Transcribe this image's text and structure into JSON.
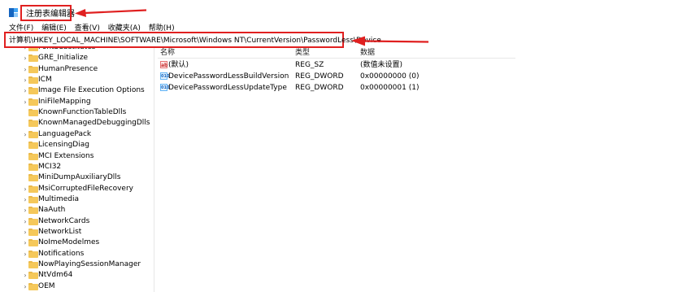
{
  "window": {
    "title": "注册表编辑器",
    "icon": "registry-editor-icon"
  },
  "menu": [
    "文件(F)",
    "编辑(E)",
    "查看(V)",
    "收藏夹(A)",
    "帮助(H)"
  ],
  "address": {
    "path": "计算机\\HKEY_LOCAL_MACHINE\\SOFTWARE\\Microsoft\\Windows NT\\CurrentVersion\\PasswordLess\\Device"
  },
  "tree": [
    {
      "label": "FontSubstitutes",
      "expandable": true
    },
    {
      "label": "GRE_Initialize",
      "expandable": true
    },
    {
      "label": "HumanPresence",
      "expandable": true
    },
    {
      "label": "ICM",
      "expandable": true
    },
    {
      "label": "Image File Execution Options",
      "expandable": true
    },
    {
      "label": "IniFileMapping",
      "expandable": true
    },
    {
      "label": "KnownFunctionTableDlls",
      "expandable": false
    },
    {
      "label": "KnownManagedDebuggingDlls",
      "expandable": false
    },
    {
      "label": "LanguagePack",
      "expandable": true
    },
    {
      "label": "LicensingDiag",
      "expandable": false
    },
    {
      "label": "MCI Extensions",
      "expandable": false
    },
    {
      "label": "MCI32",
      "expandable": false
    },
    {
      "label": "MiniDumpAuxiliaryDlls",
      "expandable": false
    },
    {
      "label": "MsiCorruptedFileRecovery",
      "expandable": true
    },
    {
      "label": "Multimedia",
      "expandable": true
    },
    {
      "label": "NaAuth",
      "expandable": true
    },
    {
      "label": "NetworkCards",
      "expandable": true
    },
    {
      "label": "NetworkList",
      "expandable": true
    },
    {
      "label": "NoImeModelmes",
      "expandable": true
    },
    {
      "label": "Notifications",
      "expandable": true
    },
    {
      "label": "NowPlayingSessionManager",
      "expandable": false
    },
    {
      "label": "NtVdm64",
      "expandable": true
    },
    {
      "label": "OEM",
      "expandable": true
    }
  ],
  "columns": {
    "name": "名称",
    "type": "类型",
    "data": "数据"
  },
  "values": [
    {
      "icon": "string-value-icon",
      "icon_text": "ab",
      "name": "(默认)",
      "type": "REG_SZ",
      "data": "(数值未设置)"
    },
    {
      "icon": "binary-value-icon",
      "icon_text": "010",
      "name": "DevicePasswordLessBuildVersion",
      "type": "REG_DWORD",
      "data": "0x00000000 (0)"
    },
    {
      "icon": "binary-value-icon",
      "icon_text": "010",
      "name": "DevicePasswordLessUpdateType",
      "type": "REG_DWORD",
      "data": "0x00000001 (1)"
    }
  ],
  "colors": {
    "annotation": "#e02020",
    "folder": "#f5c85a"
  }
}
